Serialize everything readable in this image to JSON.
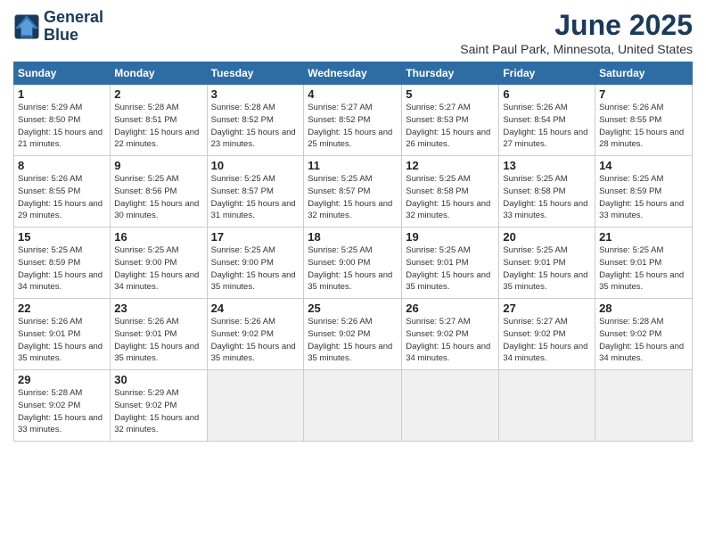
{
  "header": {
    "logo_line1": "General",
    "logo_line2": "Blue",
    "month": "June 2025",
    "location": "Saint Paul Park, Minnesota, United States"
  },
  "weekdays": [
    "Sunday",
    "Monday",
    "Tuesday",
    "Wednesday",
    "Thursday",
    "Friday",
    "Saturday"
  ],
  "weeks": [
    [
      {
        "day": "1",
        "sunrise": "Sunrise: 5:29 AM",
        "sunset": "Sunset: 8:50 PM",
        "daylight": "Daylight: 15 hours and 21 minutes."
      },
      {
        "day": "2",
        "sunrise": "Sunrise: 5:28 AM",
        "sunset": "Sunset: 8:51 PM",
        "daylight": "Daylight: 15 hours and 22 minutes."
      },
      {
        "day": "3",
        "sunrise": "Sunrise: 5:28 AM",
        "sunset": "Sunset: 8:52 PM",
        "daylight": "Daylight: 15 hours and 23 minutes."
      },
      {
        "day": "4",
        "sunrise": "Sunrise: 5:27 AM",
        "sunset": "Sunset: 8:52 PM",
        "daylight": "Daylight: 15 hours and 25 minutes."
      },
      {
        "day": "5",
        "sunrise": "Sunrise: 5:27 AM",
        "sunset": "Sunset: 8:53 PM",
        "daylight": "Daylight: 15 hours and 26 minutes."
      },
      {
        "day": "6",
        "sunrise": "Sunrise: 5:26 AM",
        "sunset": "Sunset: 8:54 PM",
        "daylight": "Daylight: 15 hours and 27 minutes."
      },
      {
        "day": "7",
        "sunrise": "Sunrise: 5:26 AM",
        "sunset": "Sunset: 8:55 PM",
        "daylight": "Daylight: 15 hours and 28 minutes."
      }
    ],
    [
      {
        "day": "8",
        "sunrise": "Sunrise: 5:26 AM",
        "sunset": "Sunset: 8:55 PM",
        "daylight": "Daylight: 15 hours and 29 minutes."
      },
      {
        "day": "9",
        "sunrise": "Sunrise: 5:25 AM",
        "sunset": "Sunset: 8:56 PM",
        "daylight": "Daylight: 15 hours and 30 minutes."
      },
      {
        "day": "10",
        "sunrise": "Sunrise: 5:25 AM",
        "sunset": "Sunset: 8:57 PM",
        "daylight": "Daylight: 15 hours and 31 minutes."
      },
      {
        "day": "11",
        "sunrise": "Sunrise: 5:25 AM",
        "sunset": "Sunset: 8:57 PM",
        "daylight": "Daylight: 15 hours and 32 minutes."
      },
      {
        "day": "12",
        "sunrise": "Sunrise: 5:25 AM",
        "sunset": "Sunset: 8:58 PM",
        "daylight": "Daylight: 15 hours and 32 minutes."
      },
      {
        "day": "13",
        "sunrise": "Sunrise: 5:25 AM",
        "sunset": "Sunset: 8:58 PM",
        "daylight": "Daylight: 15 hours and 33 minutes."
      },
      {
        "day": "14",
        "sunrise": "Sunrise: 5:25 AM",
        "sunset": "Sunset: 8:59 PM",
        "daylight": "Daylight: 15 hours and 33 minutes."
      }
    ],
    [
      {
        "day": "15",
        "sunrise": "Sunrise: 5:25 AM",
        "sunset": "Sunset: 8:59 PM",
        "daylight": "Daylight: 15 hours and 34 minutes."
      },
      {
        "day": "16",
        "sunrise": "Sunrise: 5:25 AM",
        "sunset": "Sunset: 9:00 PM",
        "daylight": "Daylight: 15 hours and 34 minutes."
      },
      {
        "day": "17",
        "sunrise": "Sunrise: 5:25 AM",
        "sunset": "Sunset: 9:00 PM",
        "daylight": "Daylight: 15 hours and 35 minutes."
      },
      {
        "day": "18",
        "sunrise": "Sunrise: 5:25 AM",
        "sunset": "Sunset: 9:00 PM",
        "daylight": "Daylight: 15 hours and 35 minutes."
      },
      {
        "day": "19",
        "sunrise": "Sunrise: 5:25 AM",
        "sunset": "Sunset: 9:01 PM",
        "daylight": "Daylight: 15 hours and 35 minutes."
      },
      {
        "day": "20",
        "sunrise": "Sunrise: 5:25 AM",
        "sunset": "Sunset: 9:01 PM",
        "daylight": "Daylight: 15 hours and 35 minutes."
      },
      {
        "day": "21",
        "sunrise": "Sunrise: 5:25 AM",
        "sunset": "Sunset: 9:01 PM",
        "daylight": "Daylight: 15 hours and 35 minutes."
      }
    ],
    [
      {
        "day": "22",
        "sunrise": "Sunrise: 5:26 AM",
        "sunset": "Sunset: 9:01 PM",
        "daylight": "Daylight: 15 hours and 35 minutes."
      },
      {
        "day": "23",
        "sunrise": "Sunrise: 5:26 AM",
        "sunset": "Sunset: 9:01 PM",
        "daylight": "Daylight: 15 hours and 35 minutes."
      },
      {
        "day": "24",
        "sunrise": "Sunrise: 5:26 AM",
        "sunset": "Sunset: 9:02 PM",
        "daylight": "Daylight: 15 hours and 35 minutes."
      },
      {
        "day": "25",
        "sunrise": "Sunrise: 5:26 AM",
        "sunset": "Sunset: 9:02 PM",
        "daylight": "Daylight: 15 hours and 35 minutes."
      },
      {
        "day": "26",
        "sunrise": "Sunrise: 5:27 AM",
        "sunset": "Sunset: 9:02 PM",
        "daylight": "Daylight: 15 hours and 34 minutes."
      },
      {
        "day": "27",
        "sunrise": "Sunrise: 5:27 AM",
        "sunset": "Sunset: 9:02 PM",
        "daylight": "Daylight: 15 hours and 34 minutes."
      },
      {
        "day": "28",
        "sunrise": "Sunrise: 5:28 AM",
        "sunset": "Sunset: 9:02 PM",
        "daylight": "Daylight: 15 hours and 34 minutes."
      }
    ],
    [
      {
        "day": "29",
        "sunrise": "Sunrise: 5:28 AM",
        "sunset": "Sunset: 9:02 PM",
        "daylight": "Daylight: 15 hours and 33 minutes."
      },
      {
        "day": "30",
        "sunrise": "Sunrise: 5:29 AM",
        "sunset": "Sunset: 9:02 PM",
        "daylight": "Daylight: 15 hours and 32 minutes."
      },
      null,
      null,
      null,
      null,
      null
    ]
  ]
}
